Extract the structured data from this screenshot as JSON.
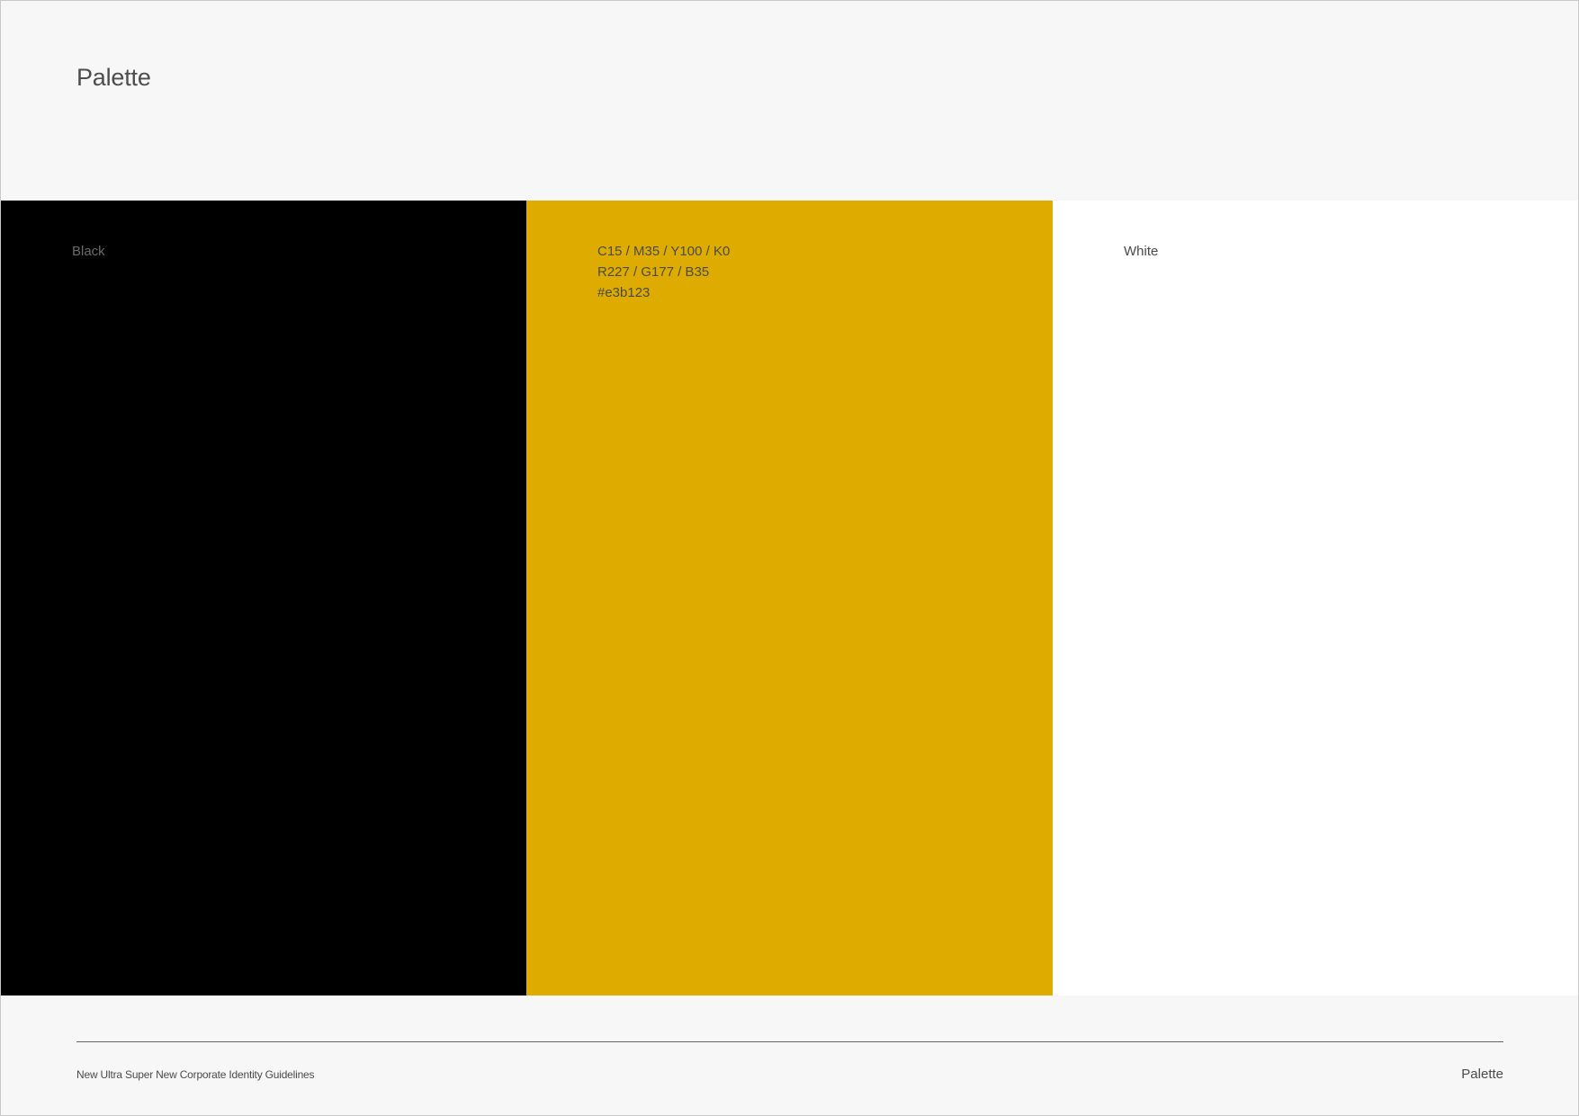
{
  "page": {
    "title": "Palette"
  },
  "swatches": [
    {
      "name": "Black",
      "color": "#000000",
      "lines": []
    },
    {
      "name": "",
      "color": "#e3b123",
      "display_color": "#deac00",
      "lines": [
        "C15 / M35 / Y100 / K0",
        "R227 / G177 / B35",
        "#e3b123"
      ]
    },
    {
      "name": "White",
      "color": "#ffffff",
      "lines": []
    }
  ],
  "footer": {
    "document_title": "New Ultra Super New Corporate Identity Guidelines",
    "section": "Palette"
  }
}
